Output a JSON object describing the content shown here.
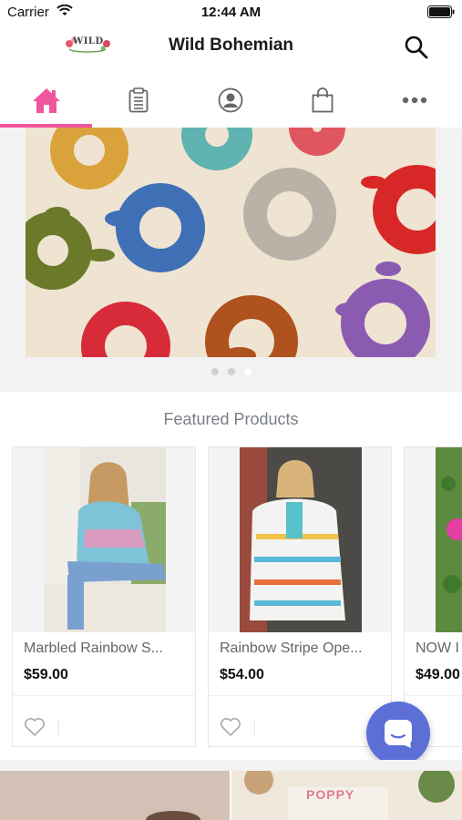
{
  "status_bar": {
    "carrier": "Carrier",
    "time": "12:44 AM"
  },
  "header": {
    "logo_text": "WILD",
    "title": "Wild Bohemian"
  },
  "tabs": [
    {
      "name": "home",
      "icon": "home-icon",
      "active": true
    },
    {
      "name": "orders",
      "icon": "clipboard-icon",
      "active": false
    },
    {
      "name": "account",
      "icon": "user-circle-icon",
      "active": false
    },
    {
      "name": "cart",
      "icon": "shopping-bag-icon",
      "active": false
    },
    {
      "name": "more",
      "icon": "more-dots-icon",
      "active": false
    }
  ],
  "banner": {
    "dots": 3,
    "active_dot": 2
  },
  "featured": {
    "title": "Featured Products",
    "products": [
      {
        "name": "Marbled Rainbow S...",
        "price": "$59.00"
      },
      {
        "name": "Rainbow Stripe Ope...",
        "price": "$54.00"
      },
      {
        "name": "NOW I",
        "price": "$49.00"
      }
    ]
  },
  "bottom": {
    "text": "POPPY"
  },
  "colors": {
    "accent": "#f0569d",
    "chat": "#5b6fd6",
    "muted": "#7a7f87"
  }
}
